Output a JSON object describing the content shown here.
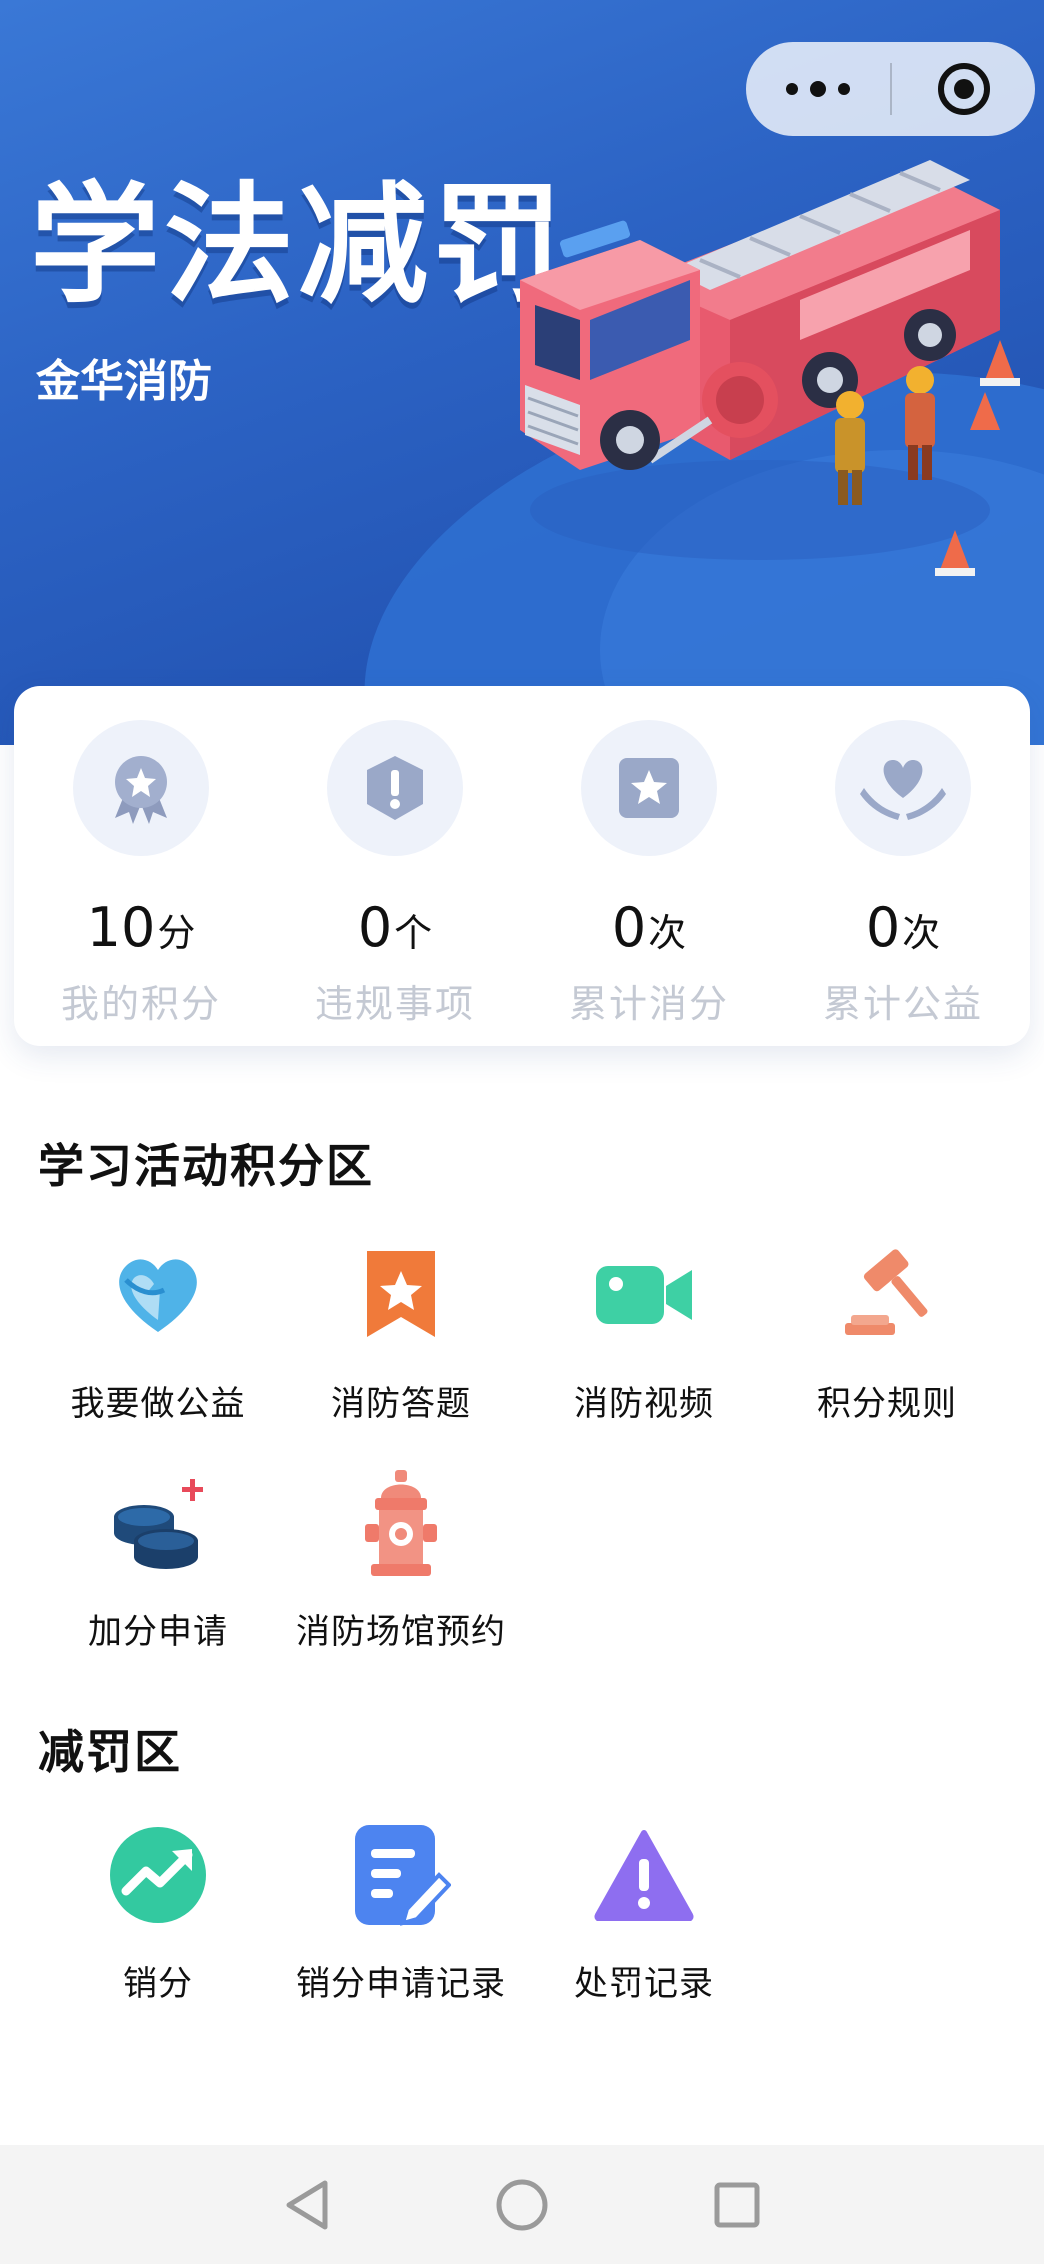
{
  "banner": {
    "title": "学法减罚",
    "subtitle": "金华消防"
  },
  "capsule": {
    "more_icon": "more-dots-icon",
    "close_icon": "target-close-icon"
  },
  "stats": [
    {
      "value": "10",
      "unit": "分",
      "label": "我的积分",
      "icon": "medal-star-icon"
    },
    {
      "value": "0",
      "unit": "个",
      "label": "违规事项",
      "icon": "exclamation-shield-icon"
    },
    {
      "value": "0",
      "unit": "次",
      "label": "累计消分",
      "icon": "star-square-icon"
    },
    {
      "value": "0",
      "unit": "次",
      "label": "累计公益",
      "icon": "heart-hands-icon"
    }
  ],
  "study_section": {
    "title": "学习活动积分区",
    "items": [
      {
        "label": "我要做公益",
        "icon": "heart-icon"
      },
      {
        "label": "消防答题",
        "icon": "bookmark-star-icon"
      },
      {
        "label": "消防视频",
        "icon": "video-camera-icon"
      },
      {
        "label": "积分规则",
        "icon": "gavel-icon"
      },
      {
        "label": "加分申请",
        "icon": "coins-plus-icon"
      },
      {
        "label": "消防场馆预约",
        "icon": "fire-hydrant-icon"
      }
    ]
  },
  "penalty_section": {
    "title": "减罚区",
    "items": [
      {
        "label": "销分",
        "icon": "trend-up-icon"
      },
      {
        "label": "销分申请记录",
        "icon": "document-edit-icon"
      },
      {
        "label": "处罚记录",
        "icon": "warning-triangle-icon"
      }
    ]
  },
  "navbar": {
    "back_icon": "back-triangle-icon",
    "home_icon": "home-circle-icon",
    "recent_icon": "recent-square-icon"
  },
  "colors": {
    "banner_blue": "#2c63c4",
    "stat_label_gray": "#c4c9d3",
    "heart_blue": "#4fb3e8",
    "bookmark_orange": "#f07a3a",
    "video_green": "#3ed0a4",
    "gavel_coral": "#ef8a6a",
    "hydrant_coral": "#f08a7a",
    "trend_green": "#33c9a0",
    "doc_blue": "#4d84f0",
    "warning_purple": "#8e6ef0"
  }
}
